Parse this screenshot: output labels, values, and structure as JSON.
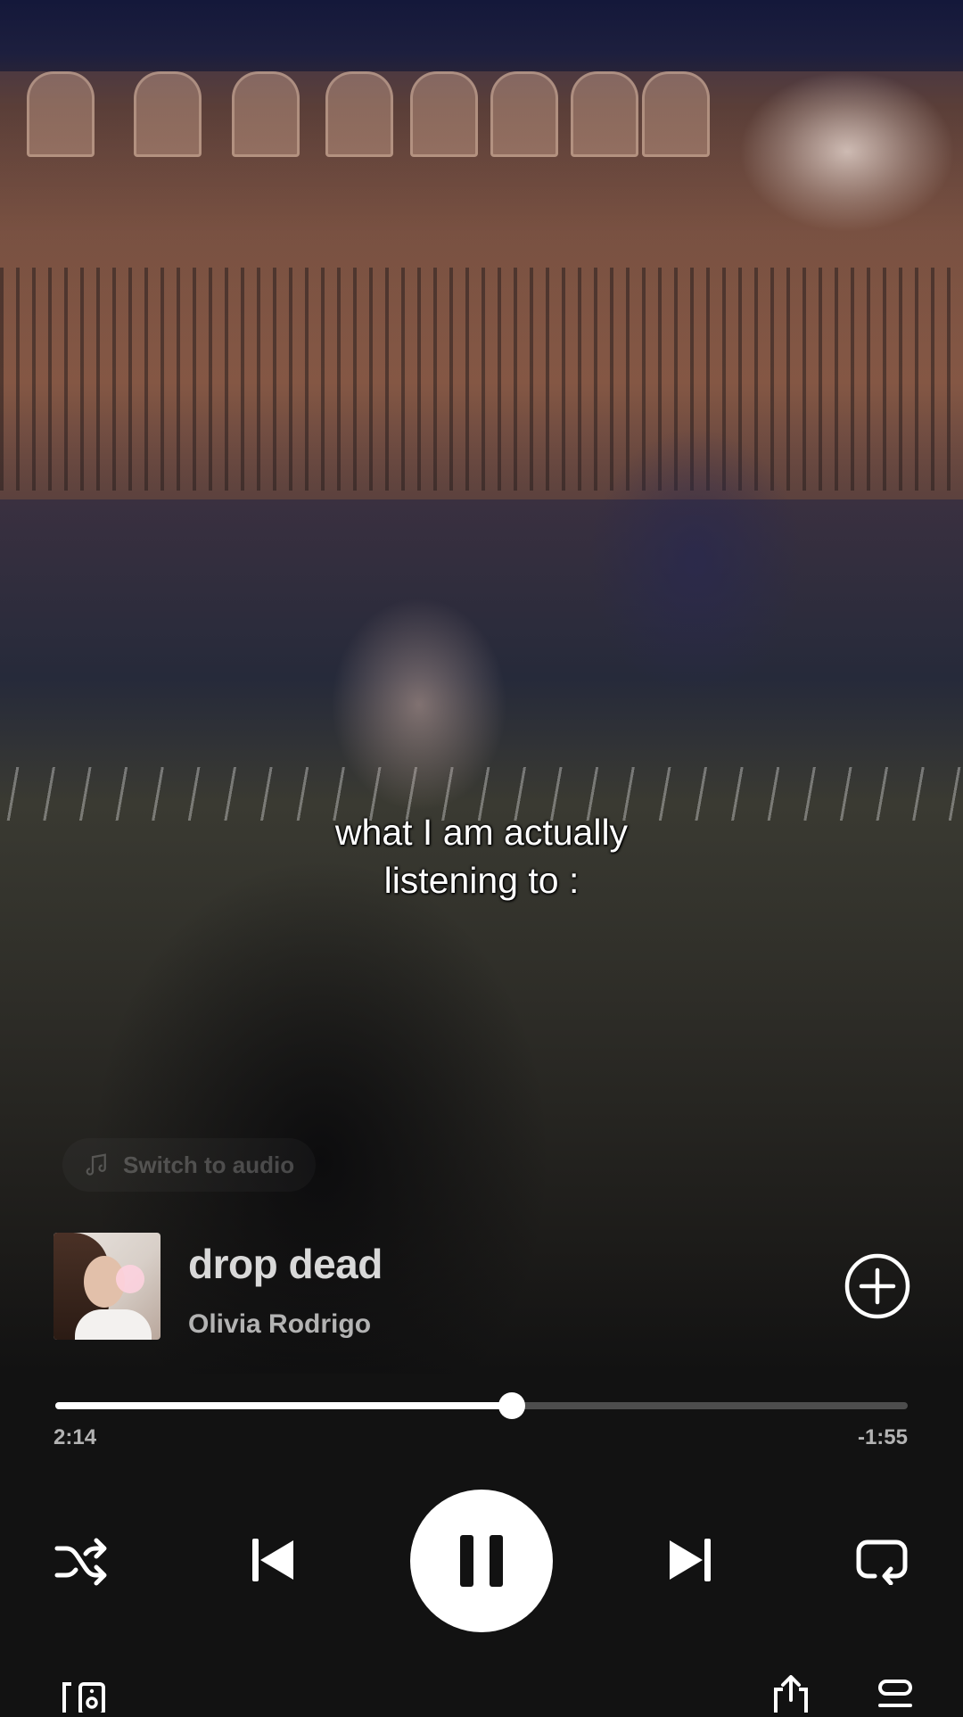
{
  "overlay": {
    "caption_line1": "what I am actually",
    "caption_line2": "listening to :",
    "switch_to_audio": "Switch to audio"
  },
  "track": {
    "title": "drop dead",
    "artist": "Olivia Rodrigo"
  },
  "playback": {
    "elapsed": "2:14",
    "remaining": "-1:55",
    "progress_fraction": 0.536,
    "state": "playing"
  },
  "icons": {
    "add": "plus-circle-icon",
    "shuffle": "shuffle-icon",
    "previous": "skip-previous-icon",
    "pause": "pause-icon",
    "next": "skip-next-icon",
    "repeat": "repeat-icon",
    "devices": "connect-device-icon",
    "share": "share-icon",
    "queue": "queue-icon"
  },
  "colors": {
    "background": "#121212",
    "primary_text": "#ffffff",
    "secondary_text": "#b3b3b3",
    "track_bar": "#4d4d4d"
  }
}
